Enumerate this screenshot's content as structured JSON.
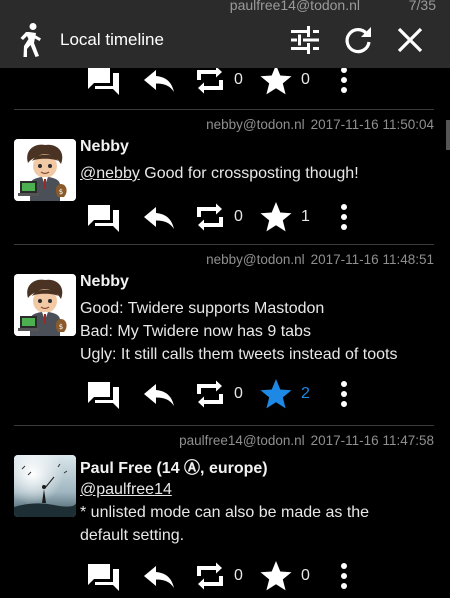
{
  "status_bar": {
    "account": "paulfree14@todon.nl",
    "count": "7/35"
  },
  "appbar": {
    "title": "Local timeline",
    "icons": [
      "runner-icon",
      "filter-icon",
      "refresh-icon",
      "close-icon"
    ]
  },
  "top_actions": {
    "boosts": "0",
    "favs": "0"
  },
  "statuses": [
    {
      "account": "nebby@todon.nl",
      "time": "2017-11-16 11:50:04",
      "name": "Nebby",
      "mention": "@nebby",
      "body_line1_rest": " Good for crossposting though!",
      "boosts": "0",
      "favs": "1"
    },
    {
      "account": "nebby@todon.nl",
      "time": "2017-11-16 11:48:51",
      "name": "Nebby",
      "lines": [
        "Good: Twidere supports Mastodon",
        "Bad: My Twidere now has 9 tabs",
        "Ugly: It still calls them tweets instead of toots"
      ],
      "boosts": "0",
      "favs": "2"
    },
    {
      "account": "paulfree14@todon.nl",
      "time": "2017-11-16 11:47:58",
      "name": "Paul Free (14 Ⓐ, europe)",
      "mention": "@paulfree14",
      "lines": [
        "* unlisted mode can also be made as the",
        "default setting."
      ],
      "boosts": "0",
      "favs": "0"
    }
  ],
  "colors": {
    "favorited": "#1e88e5",
    "appbar": "#2b2b2b",
    "background": "#000000"
  }
}
